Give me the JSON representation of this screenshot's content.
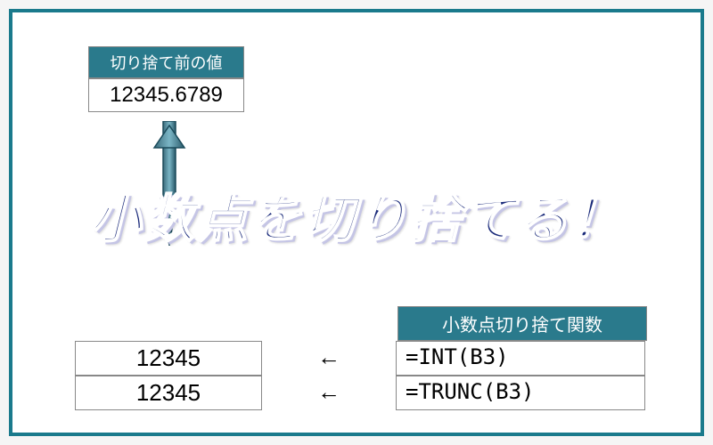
{
  "top_box": {
    "header": "切り捨て前の値",
    "value": "12345.6789"
  },
  "headline": "小数点を切り捨てる！",
  "func_header": "小数点切り捨て関数",
  "arrow_left": "←",
  "rows": [
    {
      "result": "12345",
      "formula": "=INT(B3)"
    },
    {
      "result": "12345",
      "formula": "=TRUNC(B3)"
    }
  ]
}
